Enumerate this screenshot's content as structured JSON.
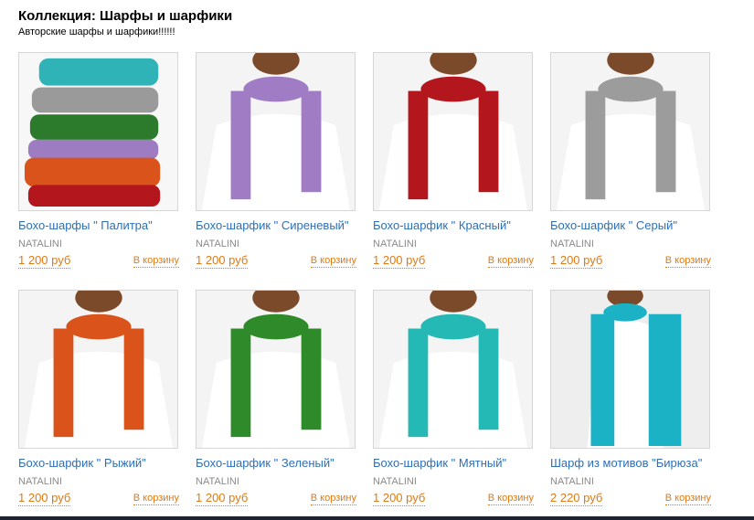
{
  "collection": {
    "title": "Коллекция: Шарфы и шарфики",
    "subtitle": "Авторские шарфы и шарфики!!!!!!"
  },
  "products": [
    {
      "title": "Бохо-шарфы \" Палитра\"",
      "author": "NATALINI",
      "price": "1 200 руб",
      "cart_label": "В корзину",
      "image": "stack-of-scarves",
      "color": "#2fb3b6"
    },
    {
      "title": "Бохо-шарфик \" Сиреневый\"",
      "author": "NATALINI",
      "price": "1 200 руб",
      "cart_label": "В корзину",
      "image": "model-with-scarf",
      "color": "#a07cc4"
    },
    {
      "title": "Бохо-шарфик \" Красный\"",
      "author": "NATALINI",
      "price": "1 200 руб",
      "cart_label": "В корзину",
      "image": "model-with-scarf",
      "color": "#b3161c"
    },
    {
      "title": "Бохо-шарфик \" Серый\"",
      "author": "NATALINI",
      "price": "1 200 руб",
      "cart_label": "В корзину",
      "image": "model-with-scarf",
      "color": "#9c9c9c"
    },
    {
      "title": "Бохо-шарфик \" Рыжий\"",
      "author": "NATALINI",
      "price": "1 200 руб",
      "cart_label": "В корзину",
      "image": "model-with-scarf",
      "color": "#d9531a"
    },
    {
      "title": "Бохо-шарфик \" Зеленый\"",
      "author": "NATALINI",
      "price": "1 200 руб",
      "cart_label": "В корзину",
      "image": "model-with-scarf",
      "color": "#2f8a2a"
    },
    {
      "title": "Бохо-шарфик \" Мятный\"",
      "author": "NATALINI",
      "price": "1 200 руб",
      "cart_label": "В корзину",
      "image": "model-with-scarf",
      "color": "#25b9b5"
    },
    {
      "title": "Шарф из мотивов \"Бирюза\"",
      "author": "NATALINI",
      "price": "2 220 руб",
      "cart_label": "В корзину",
      "image": "model-with-scarf-side",
      "color": "#1ab2c4"
    }
  ]
}
